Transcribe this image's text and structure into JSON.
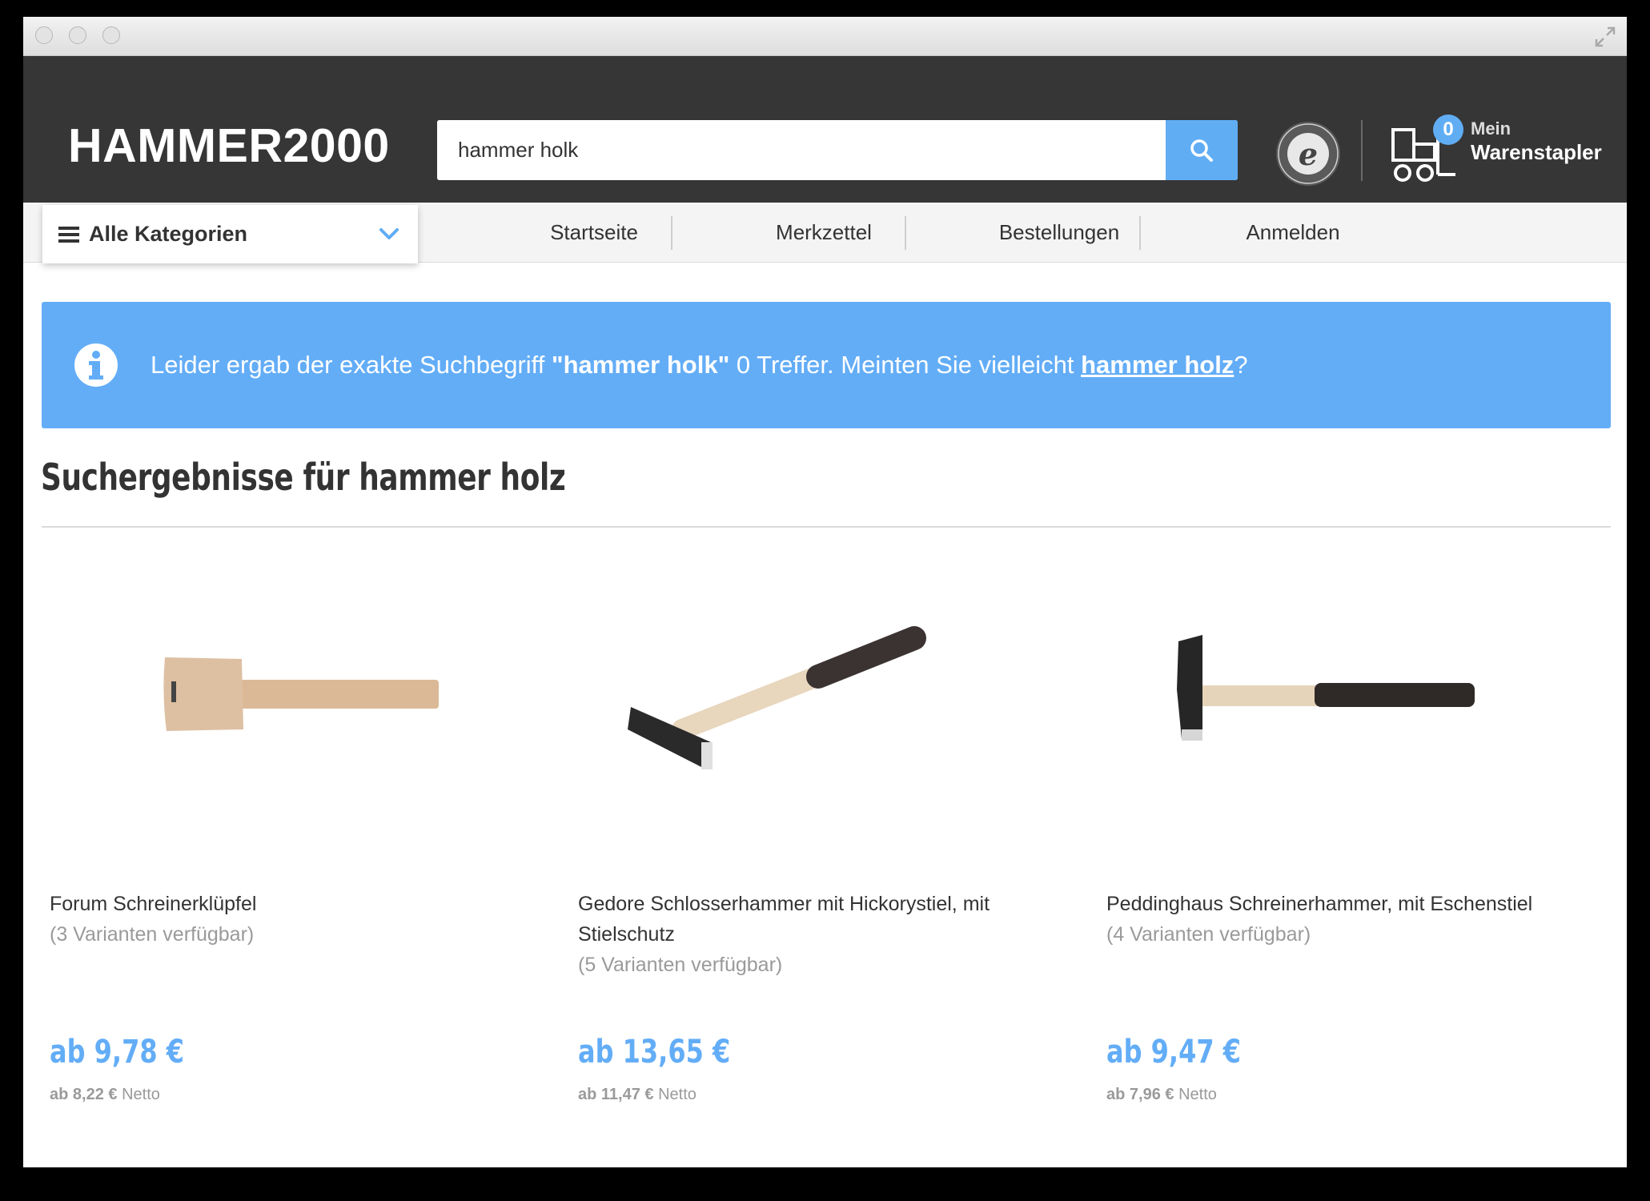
{
  "header": {
    "logo": "HAMMER2000",
    "search": {
      "value": "hammer holk"
    },
    "cart": {
      "count": "0",
      "label_line1": "Mein",
      "label_line2": "Warenstapler"
    }
  },
  "nav": {
    "categories_label": "Alle Kategorien",
    "items": [
      {
        "label": "Startseite"
      },
      {
        "label": "Merkzettel"
      },
      {
        "label": "Bestellungen"
      },
      {
        "label": "Anmelden"
      }
    ]
  },
  "alert": {
    "prefix": "Leider ergab der exakte Suchbegriff ",
    "term": "\"hammer holk\"",
    "middle": " 0 Treffer. Meinten Sie vielleicht ",
    "suggestion": "hammer holz",
    "suffix": "?"
  },
  "results": {
    "title": "Suchergebnisse für hammer holz",
    "products": [
      {
        "name": "Forum Schreinerklüpfel",
        "variants": "(3 Varianten verfügbar)",
        "price": "ab 9,78 €",
        "net_price": "ab 8,22 €",
        "net_label": " Netto"
      },
      {
        "name": "Gedore Schlosserhammer mit Hickorystiel, mit Stielschutz",
        "variants": "(5 Varianten verfügbar)",
        "price": "ab 13,65 €",
        "net_price": "ab 11,47 €",
        "net_label": " Netto"
      },
      {
        "name": "Peddinghaus Schreinerhammer, mit Eschenstiel",
        "variants": "(4 Varianten verfügbar)",
        "price": "ab 9,47 €",
        "net_price": "ab 7,96 €",
        "net_label": " Netto"
      }
    ]
  },
  "colors": {
    "accent": "#63adf7",
    "header_bg": "#363636"
  }
}
